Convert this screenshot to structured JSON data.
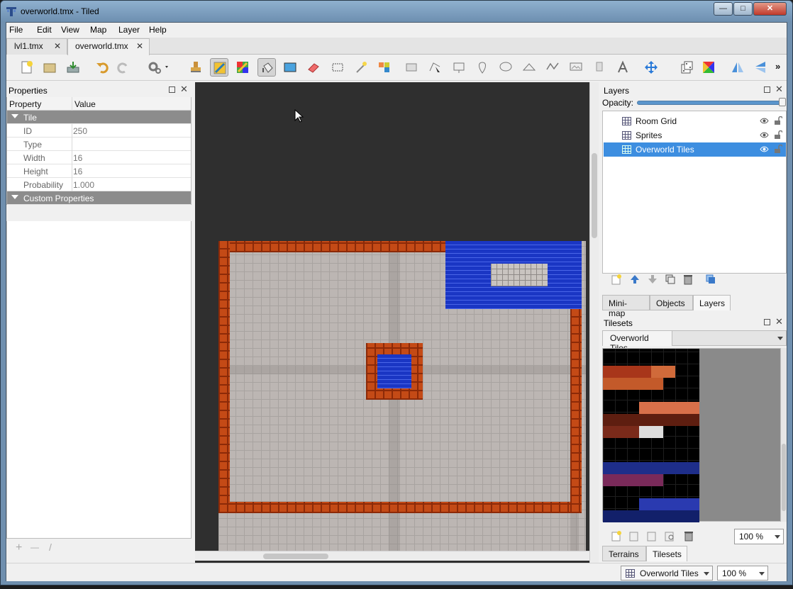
{
  "window": {
    "title": "overworld.tmx - Tiled",
    "controls": [
      "—",
      "□",
      "✕"
    ]
  },
  "menu": [
    "File",
    "Edit",
    "View",
    "Map",
    "Layer",
    "Help"
  ],
  "tabs": [
    {
      "label": "lvl1.tmx"
    },
    {
      "label": "overworld.tmx"
    }
  ],
  "tab_close": "✕",
  "toolbar": {
    "more": "»"
  },
  "properties": {
    "title": "Properties",
    "columns": [
      "Property",
      "Value"
    ],
    "group_tile": "Tile",
    "rows": [
      {
        "key": "ID",
        "value": "250"
      },
      {
        "key": "Type",
        "value": ""
      },
      {
        "key": "Width",
        "value": "16"
      },
      {
        "key": "Height",
        "value": "16"
      },
      {
        "key": "Probability",
        "value": "1.000"
      }
    ],
    "group_custom": "Custom Properties",
    "footer": [
      "+",
      "—",
      "/"
    ]
  },
  "layers": {
    "title": "Layers",
    "opacity_label": "Opacity:",
    "opacity": 1.0,
    "items": [
      {
        "name": "Room Grid",
        "selected": false
      },
      {
        "name": "Sprites",
        "selected": false
      },
      {
        "name": "Overworld Tiles",
        "selected": true
      }
    ],
    "tabs": [
      "Mini-map",
      "Objects",
      "Layers"
    ]
  },
  "tilesets": {
    "title": "Tilesets",
    "current": "Overworld Tiles",
    "zoom": "100 %",
    "tabs": [
      "Terrains",
      "Tilesets"
    ]
  },
  "status": {
    "layer": "Overworld Tiles",
    "zoom": "100 %"
  },
  "colors": {
    "selection": "#3d8ee0",
    "brick": "#c44a16",
    "water": "#1a36c4",
    "floor": "#bcb6b3"
  }
}
